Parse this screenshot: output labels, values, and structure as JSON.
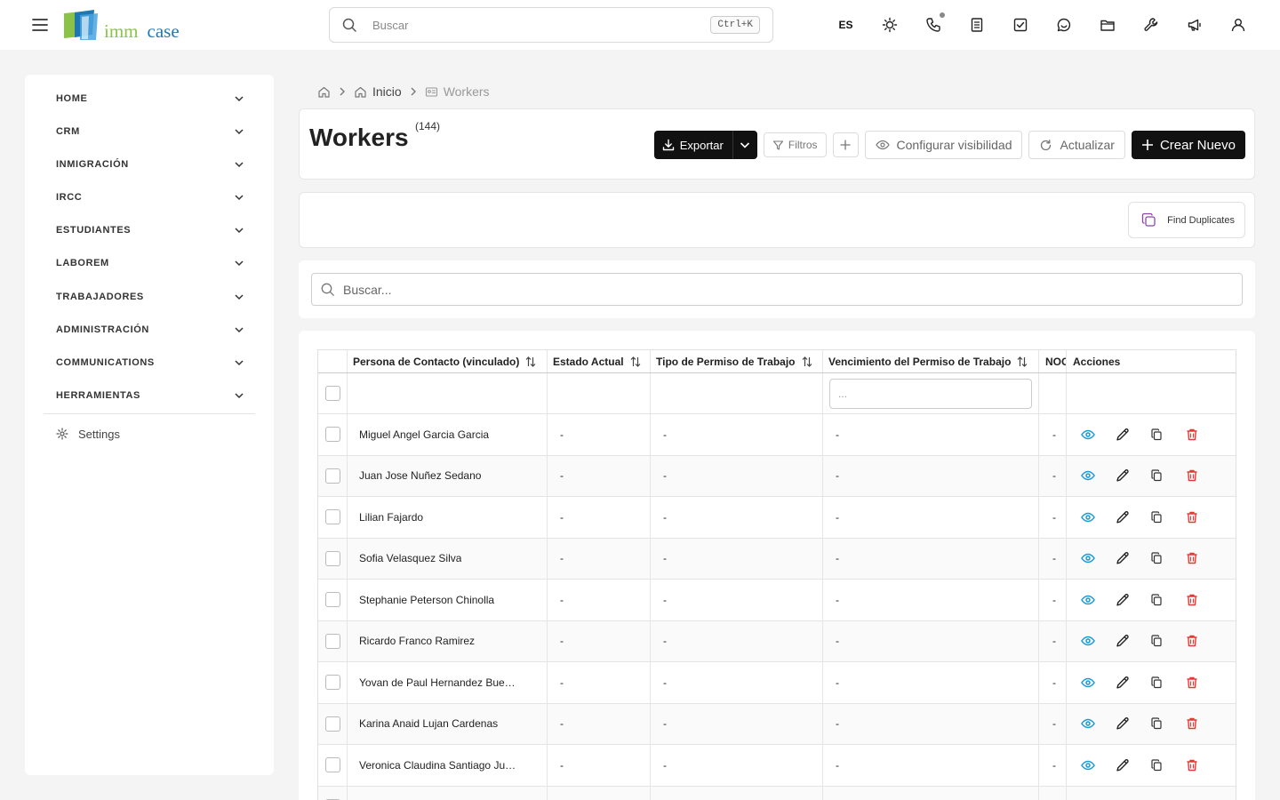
{
  "topbar": {
    "logo": {
      "imm": "imm",
      "case": "case"
    },
    "search": {
      "placeholder": "Buscar",
      "shortcut": "Ctrl+K"
    },
    "language": "ES",
    "icons": [
      "sun-icon",
      "phone-icon",
      "notes-icon",
      "checklist-icon",
      "chat-icon",
      "folder-icon",
      "wrench-icon",
      "megaphone-icon",
      "user-icon"
    ]
  },
  "sidebar": {
    "items": [
      {
        "label": "HOME"
      },
      {
        "label": "CRM"
      },
      {
        "label": "INMIGRACIÓN"
      },
      {
        "label": "IRCC"
      },
      {
        "label": "ESTUDIANTES"
      },
      {
        "label": "LABOREM"
      },
      {
        "label": "TRABAJADORES"
      },
      {
        "label": "ADMINISTRACIÓN"
      },
      {
        "label": "COMMUNICATIONS"
      },
      {
        "label": "HERRAMIENTAS"
      }
    ],
    "settings_label": "Settings"
  },
  "breadcrumb": {
    "inicio": "Inicio",
    "current": "Workers"
  },
  "header": {
    "title": "Workers",
    "count": "(144)",
    "export_label": "Exportar",
    "filters_label": "Filtros",
    "visibility_label": "Configurar visibilidad",
    "refresh_label": "Actualizar",
    "create_label": "Crear Nuevo"
  },
  "duplicates": {
    "label": "Find Duplicates"
  },
  "table_search": {
    "placeholder": "Buscar..."
  },
  "table": {
    "columns": [
      "Persona de Contacto (vinculado)",
      "Estado Actual",
      "Tipo de Permiso de Trabajo",
      "Vencimiento del Permiso de Trabajo",
      "NOC",
      "Acciones"
    ],
    "filter_placeholder": "...",
    "rows": [
      {
        "name": "Miguel Angel Garcia Garcia",
        "estado": "-",
        "tipo": "-",
        "vencimiento": "-",
        "noc": "-"
      },
      {
        "name": "Juan Jose Nuñez Sedano",
        "estado": "-",
        "tipo": "-",
        "vencimiento": "-",
        "noc": "-"
      },
      {
        "name": "Lilian Fajardo",
        "estado": "-",
        "tipo": "-",
        "vencimiento": "-",
        "noc": "-"
      },
      {
        "name": "Sofia Velasquez Silva",
        "estado": "-",
        "tipo": "-",
        "vencimiento": "-",
        "noc": "-"
      },
      {
        "name": "Stephanie Peterson Chinolla",
        "estado": "-",
        "tipo": "-",
        "vencimiento": "-",
        "noc": "-"
      },
      {
        "name": "Ricardo Franco Ramirez",
        "estado": "-",
        "tipo": "-",
        "vencimiento": "-",
        "noc": "-"
      },
      {
        "name": "Yovan de Paul Hernandez Bue…",
        "estado": "-",
        "tipo": "-",
        "vencimiento": "-",
        "noc": "-"
      },
      {
        "name": "Karina Anaid Lujan Cardenas",
        "estado": "-",
        "tipo": "-",
        "vencimiento": "-",
        "noc": "-"
      },
      {
        "name": "Veronica Claudina Santiago Ju…",
        "estado": "-",
        "tipo": "-",
        "vencimiento": "-",
        "noc": "-"
      },
      {
        "name": "",
        "estado": "",
        "tipo": "",
        "vencimiento": "",
        "noc": ""
      }
    ],
    "action_icons": [
      "eye-icon",
      "pencil-icon",
      "copy-icon",
      "trash-icon"
    ]
  },
  "colors": {
    "accent_dark": "#111111",
    "view_icon": "#1a9bd7",
    "delete_icon": "#e53935",
    "duplicates_icon": "#8e44ad"
  }
}
